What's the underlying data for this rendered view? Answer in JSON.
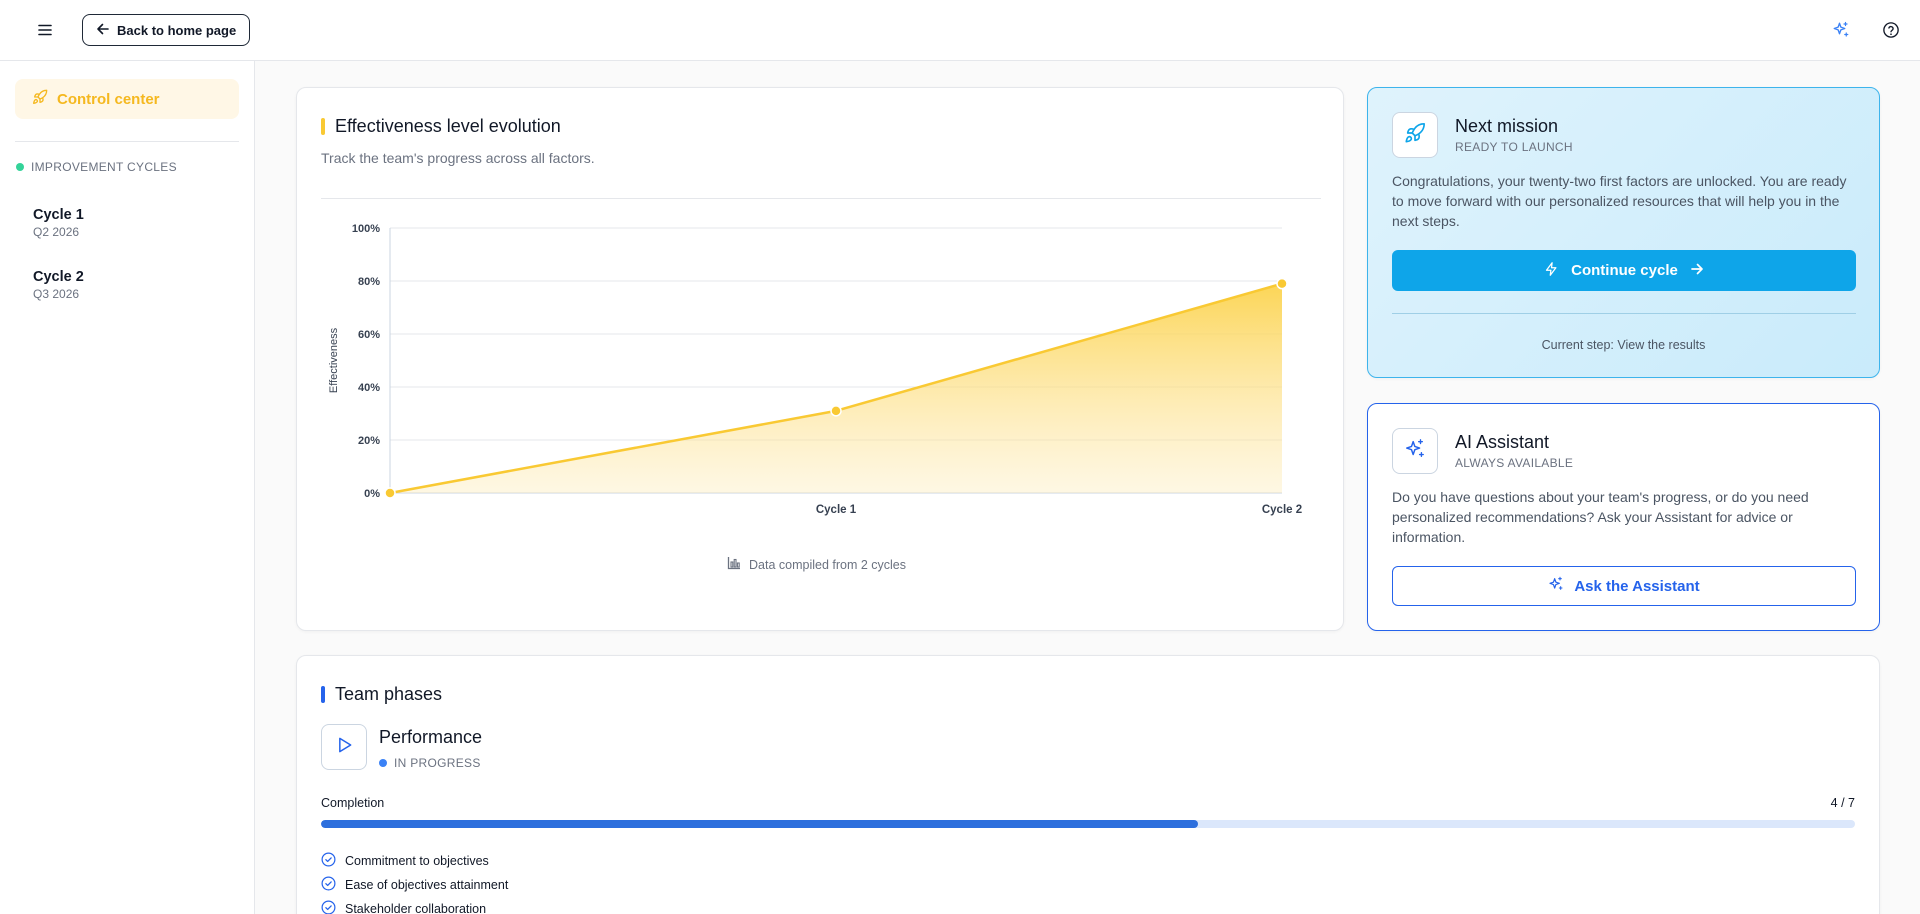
{
  "header": {
    "back_label": "Back to home page",
    "icons": [
      "menu-icon",
      "arrow-left-icon",
      "sparkles-icon",
      "help-circle-icon"
    ]
  },
  "sidebar": {
    "control_center": "Control center",
    "section_label": "IMPROVEMENT CYCLES",
    "cycles": [
      {
        "name": "Cycle 1",
        "period": "Q2 2026"
      },
      {
        "name": "Cycle 2",
        "period": "Q3 2026"
      }
    ]
  },
  "chart_card": {
    "title": "Effectiveness level evolution",
    "subtitle": "Track the team's progress across all factors.",
    "footer": "Data compiled from 2 cycles"
  },
  "chart_data": {
    "type": "area",
    "categories": [
      "",
      "Cycle 1",
      "Cycle 2"
    ],
    "values": [
      0,
      31,
      79
    ],
    "ylabel": "Effectiveness",
    "xlabel": "",
    "ylim": [
      0,
      100
    ],
    "yticks": [
      "0%",
      "20%",
      "40%",
      "60%",
      "80%",
      "100%"
    ],
    "grid": true,
    "color": "#f9c933"
  },
  "mission": {
    "title": "Next mission",
    "tag": "READY TO LAUNCH",
    "text": "Congratulations, your twenty-two first factors are unlocked. You are ready to move forward with our personalized resources that will help you in the next steps.",
    "button": "Continue cycle",
    "current_step": "Current step: View the results"
  },
  "assistant": {
    "title": "AI Assistant",
    "tag": "ALWAYS AVAILABLE",
    "text": "Do you have questions about your team's progress, or do you need personalized recommendations? Ask your Assistant for advice or information.",
    "button": "Ask the Assistant"
  },
  "phases": {
    "title": "Team phases",
    "phase_name": "Performance",
    "status": "IN PROGRESS",
    "completion_label": "Completion",
    "completion_count": "4 / 7",
    "completion_fraction": 0.5714,
    "factors": [
      "Commitment to objectives",
      "Ease of objectives attainment",
      "Stakeholder collaboration"
    ]
  },
  "colors": {
    "accent_yellow": "#f5b81f",
    "accent_blue": "#2563eb",
    "mission_button": "#0ea5e9"
  }
}
